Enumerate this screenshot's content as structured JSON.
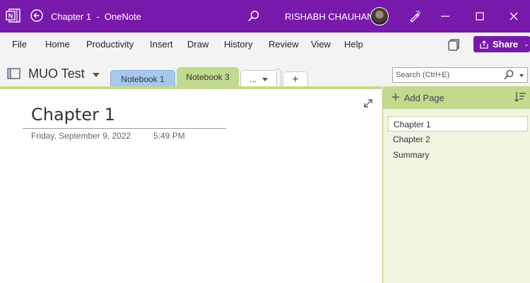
{
  "titlebar": {
    "title": "Chapter 1  -  OneNote",
    "user_name": "RISHABH CHAUHAN",
    "colors": {
      "accent": "#7719aa"
    }
  },
  "menu": {
    "items": [
      "File",
      "Home",
      "Productivity",
      "Insert",
      "Draw",
      "History",
      "Review",
      "View",
      "Help"
    ],
    "share_label": "Share"
  },
  "notebook": {
    "name": "MUO Test",
    "tabs": [
      {
        "label": "Notebook 1",
        "color": "#a6c7ee"
      },
      {
        "label": "Notebook 3",
        "color": "#c2da8e",
        "selected": true
      }
    ],
    "more_label": "...",
    "add_label": "+",
    "search_placeholder": "Search (Ctrl+E)"
  },
  "page": {
    "title": "Chapter 1",
    "date": "Friday, September 9, 2022",
    "time": "5:49 PM"
  },
  "pages_pane": {
    "add_page_label": "Add Page",
    "pages": [
      {
        "label": "Chapter 1",
        "selected": true
      },
      {
        "label": "Chapter 2",
        "selected": false
      },
      {
        "label": "Summary",
        "selected": false
      }
    ]
  },
  "icons": [
    "onenote-app-icon",
    "back-icon",
    "search-icon",
    "pen-icon",
    "minimize-icon",
    "maximize-icon",
    "close-icon",
    "view-icon",
    "share-icon",
    "notebook-icon",
    "expand-icon",
    "sort-icon"
  ]
}
